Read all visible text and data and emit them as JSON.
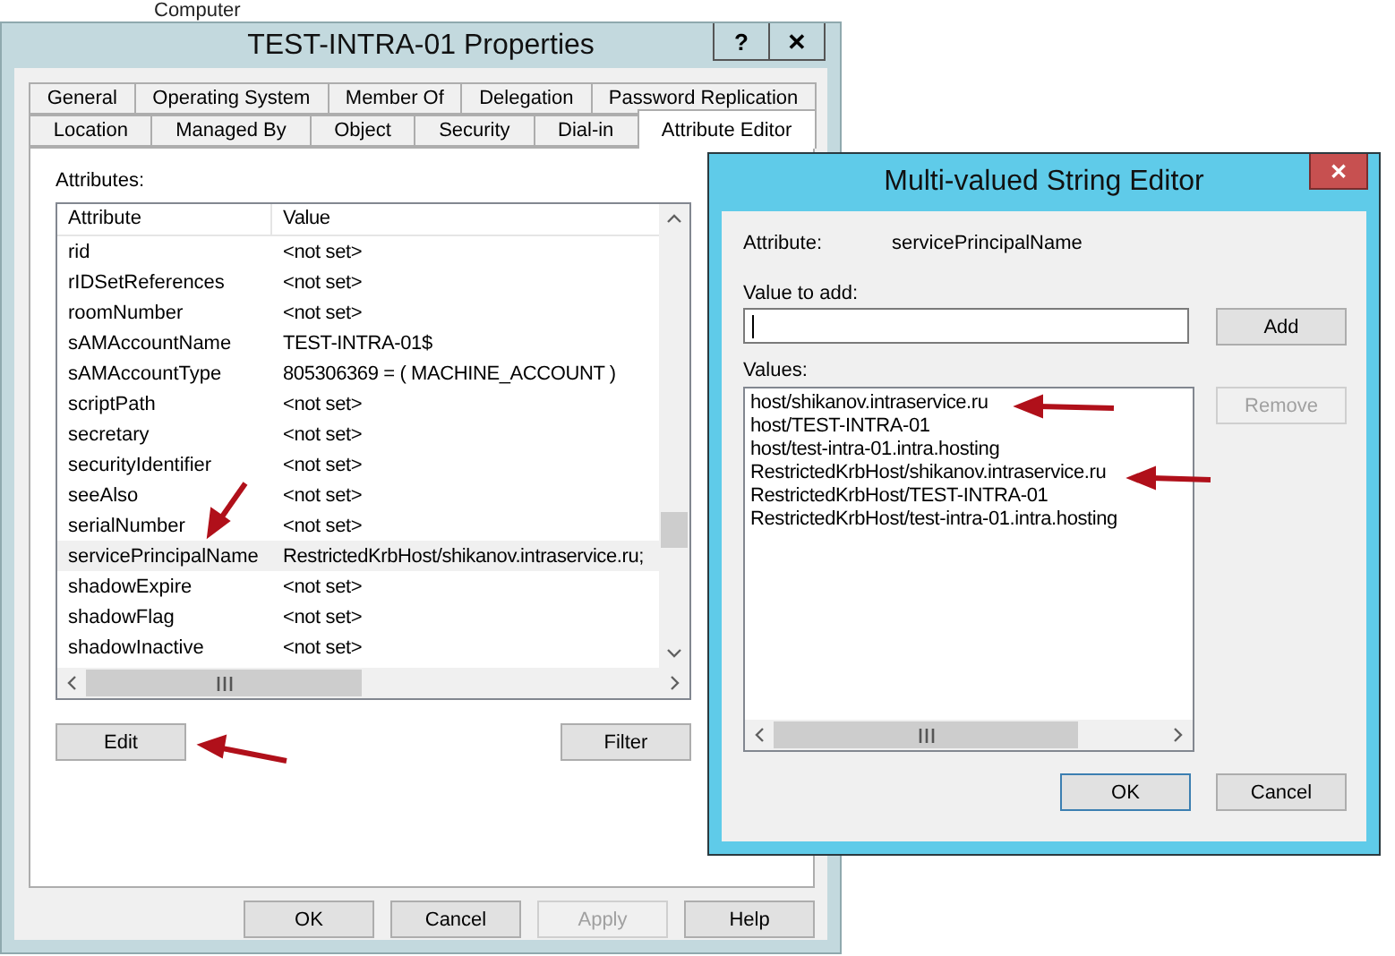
{
  "background_window": {
    "text": "Computer"
  },
  "window": {
    "title": "TEST-INTRA-01 Properties",
    "help_button": "?",
    "close_button": "✕"
  },
  "tab_rows": [
    [
      {
        "label": "General",
        "selected": false
      },
      {
        "label": "Operating System",
        "selected": false
      },
      {
        "label": "Member Of",
        "selected": false
      },
      {
        "label": "Delegation",
        "selected": false
      },
      {
        "label": "Password Replication",
        "selected": false
      }
    ],
    [
      {
        "label": "Location",
        "selected": false
      },
      {
        "label": "Managed By",
        "selected": false
      },
      {
        "label": "Object",
        "selected": false
      },
      {
        "label": "Security",
        "selected": false
      },
      {
        "label": "Dial-in",
        "selected": false
      },
      {
        "label": "Attribute Editor",
        "selected": true
      }
    ]
  ],
  "attributes_label": "Attributes:",
  "table": {
    "columns": [
      "Attribute",
      "Value"
    ],
    "rows": [
      {
        "attribute": "rid",
        "value": "<not set>",
        "selected": false
      },
      {
        "attribute": "rIDSetReferences",
        "value": "<not set>",
        "selected": false
      },
      {
        "attribute": "roomNumber",
        "value": "<not set>",
        "selected": false
      },
      {
        "attribute": "sAMAccountName",
        "value": "TEST-INTRA-01$",
        "selected": false
      },
      {
        "attribute": "sAMAccountType",
        "value": "805306369 = ( MACHINE_ACCOUNT )",
        "selected": false
      },
      {
        "attribute": "scriptPath",
        "value": "<not set>",
        "selected": false
      },
      {
        "attribute": "secretary",
        "value": "<not set>",
        "selected": false
      },
      {
        "attribute": "securityIdentifier",
        "value": "<not set>",
        "selected": false
      },
      {
        "attribute": "seeAlso",
        "value": "<not set>",
        "selected": false
      },
      {
        "attribute": "serialNumber",
        "value": "<not set>",
        "selected": false
      },
      {
        "attribute": "servicePrincipalName",
        "value": "RestrictedKrbHost/shikanov.intraservice.ru;",
        "selected": true
      },
      {
        "attribute": "shadowExpire",
        "value": "<not set>",
        "selected": false
      },
      {
        "attribute": "shadowFlag",
        "value": "<not set>",
        "selected": false
      },
      {
        "attribute": "shadowInactive",
        "value": "<not set>",
        "selected": false
      }
    ]
  },
  "panel_buttons": [
    {
      "label": "Edit",
      "disabled": false
    },
    {
      "label": "Filter",
      "disabled": false
    }
  ],
  "dialog_buttons": [
    {
      "label": "OK",
      "disabled": false
    },
    {
      "label": "Cancel",
      "disabled": false
    },
    {
      "label": "Apply",
      "disabled": true
    },
    {
      "label": "Help",
      "disabled": false
    }
  ],
  "editor": {
    "title": "Multi-valued String Editor",
    "close_button": "✕",
    "attribute_label": "Attribute:",
    "attribute_value": "servicePrincipalName",
    "value_to_add_label": "Value to add:",
    "values_label": "Values:",
    "values": [
      "host/shikanov.intraservice.ru",
      "host/TEST-INTRA-01",
      "host/test-intra-01.intra.hosting",
      "RestrictedKrbHost/shikanov.intraservice.ru",
      "RestrictedKrbHost/TEST-INTRA-01",
      "RestrictedKrbHost/test-intra-01.intra.hosting"
    ],
    "side_buttons": [
      {
        "label": "Add",
        "disabled": false
      },
      {
        "label": "Remove",
        "disabled": true
      }
    ],
    "buttons": [
      {
        "label": "OK",
        "default": true
      },
      {
        "label": "Cancel",
        "default": false
      }
    ]
  }
}
